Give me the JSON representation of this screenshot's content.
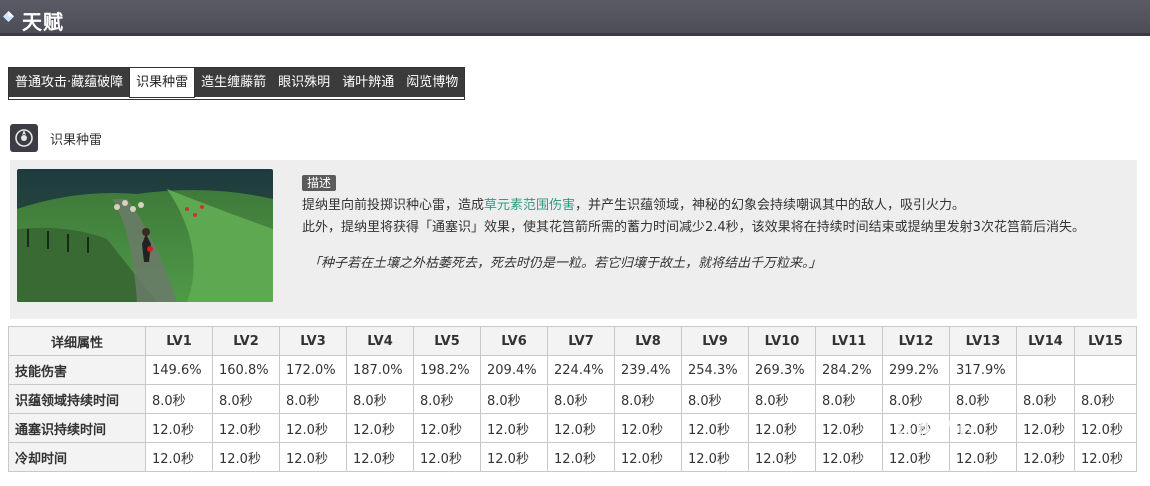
{
  "page": {
    "title": "天赋"
  },
  "tabs": [
    {
      "label": "普通攻击·藏蕴破障",
      "active": false
    },
    {
      "label": "识果种雷",
      "active": true
    },
    {
      "label": "造生缠藤箭",
      "active": false
    },
    {
      "label": "眼识殊明",
      "active": false
    },
    {
      "label": "诸叶辨通",
      "active": false
    },
    {
      "label": "闳览博物",
      "active": false
    }
  ],
  "skill": {
    "name": "识果种雷",
    "icon": "skill-emblem-icon",
    "badge": "描述",
    "desc_1_pre": "提纳里向前投掷识种心雷，造成",
    "desc_1_hl": "草元素范围伤害",
    "desc_1_post": "，并产生识蕴领域，神秘的幻象会持续嘲讽其中的敌人，吸引火力。",
    "desc_2": "此外，提纳里将获得「通塞识」效果，使其花筥箭所需的蓄力时间减少2.4秒，该效果将在持续时间结束或提纳里发射3次花筥箭后消失。",
    "quote": "「种子若在土壤之外枯萎死去，死去时仍是一粒。若它归壤于故土，就将结出千万粒来。」",
    "highlight_color": "#2e9c82"
  },
  "table": {
    "header_label": "详细属性",
    "levels": [
      "LV1",
      "LV2",
      "LV3",
      "LV4",
      "LV5",
      "LV6",
      "LV7",
      "LV8",
      "LV9",
      "LV10",
      "LV11",
      "LV12",
      "LV13",
      "LV14",
      "LV15"
    ],
    "rows": [
      {
        "label": "技能伤害",
        "values": [
          "149.6%",
          "160.8%",
          "172.0%",
          "187.0%",
          "198.2%",
          "209.4%",
          "224.4%",
          "239.4%",
          "254.3%",
          "269.3%",
          "284.2%",
          "299.2%",
          "317.9%",
          "",
          ""
        ]
      },
      {
        "label": "识蕴领域持续时间",
        "values": [
          "8.0秒",
          "8.0秒",
          "8.0秒",
          "8.0秒",
          "8.0秒",
          "8.0秒",
          "8.0秒",
          "8.0秒",
          "8.0秒",
          "8.0秒",
          "8.0秒",
          "8.0秒",
          "8.0秒",
          "8.0秒",
          "8.0秒"
        ]
      },
      {
        "label": "通塞识持续时间",
        "values": [
          "12.0秒",
          "12.0秒",
          "12.0秒",
          "12.0秒",
          "12.0秒",
          "12.0秒",
          "12.0秒",
          "12.0秒",
          "12.0秒",
          "12.0秒",
          "12.0秒",
          "12.0秒",
          "12.0秒",
          "12.0秒",
          "12.0秒"
        ]
      },
      {
        "label": "冷却时间",
        "values": [
          "12.0秒",
          "12.0秒",
          "12.0秒",
          "12.0秒",
          "12.0秒",
          "12.0秒",
          "12.0秒",
          "12.0秒",
          "12.0秒",
          "12.0秒",
          "12.0秒",
          "12.0秒",
          "12.0秒",
          "12.0秒",
          "12.0秒"
        ]
      }
    ]
  },
  "watermark": "GAME"
}
